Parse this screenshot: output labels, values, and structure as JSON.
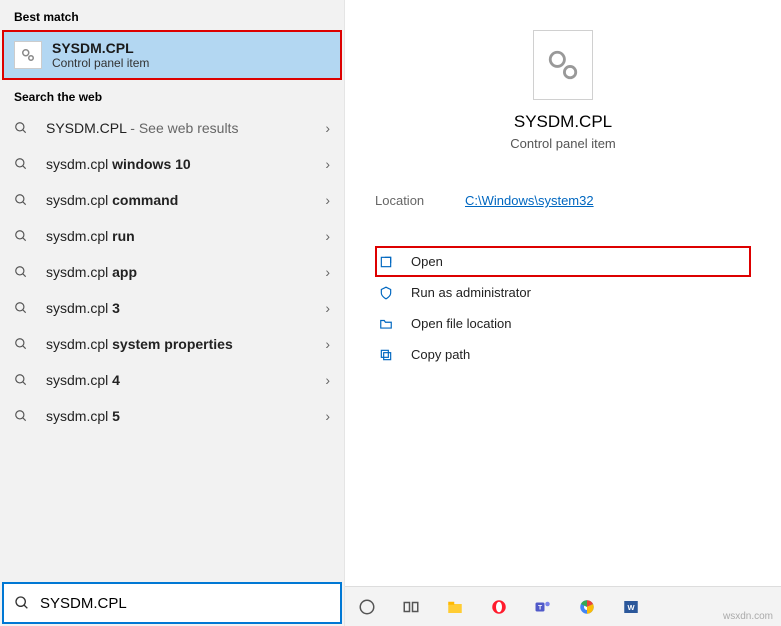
{
  "left": {
    "best_match_label": "Best match",
    "best_match": {
      "title": "SYSDM.CPL",
      "sub": "Control panel item"
    },
    "search_web_label": "Search the web",
    "results": [
      {
        "pre": "SYSDM.CPL",
        "light": " - See web results",
        "bold": ""
      },
      {
        "pre": "sysdm.cpl ",
        "light": "",
        "bold": "windows 10"
      },
      {
        "pre": "sysdm.cpl ",
        "light": "",
        "bold": "command"
      },
      {
        "pre": "sysdm.cpl ",
        "light": "",
        "bold": "run"
      },
      {
        "pre": "sysdm.cpl ",
        "light": "",
        "bold": "app"
      },
      {
        "pre": "sysdm.cpl ",
        "light": "",
        "bold": "3"
      },
      {
        "pre": "sysdm.cpl ",
        "light": "",
        "bold": "system properties"
      },
      {
        "pre": "sysdm.cpl ",
        "light": "",
        "bold": "4"
      },
      {
        "pre": "sysdm.cpl ",
        "light": "",
        "bold": "5"
      }
    ],
    "search_value": "SYSDM.CPL"
  },
  "right": {
    "title": "SYSDM.CPL",
    "sub": "Control panel item",
    "location_label": "Location",
    "location_value": "C:\\Windows\\system32",
    "actions": {
      "open": "Open",
      "admin": "Run as administrator",
      "loc": "Open file location",
      "copy": "Copy path"
    }
  },
  "watermark": "wsxdn.com"
}
